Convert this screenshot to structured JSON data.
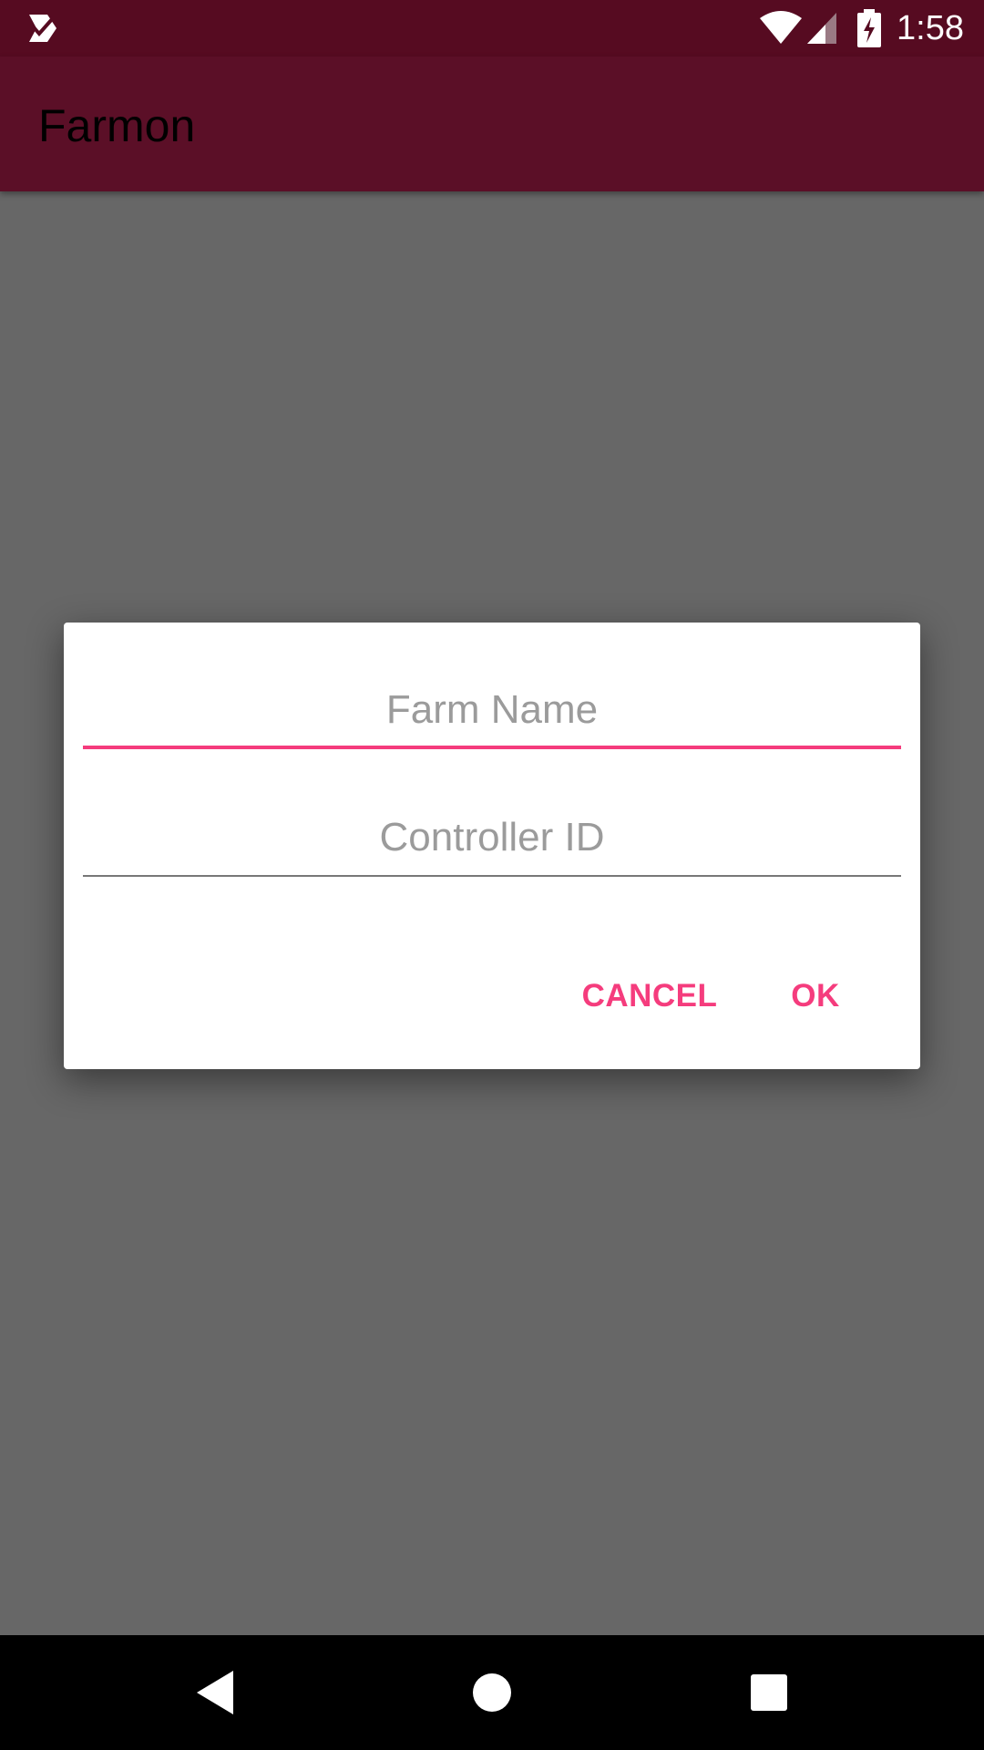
{
  "status_bar": {
    "time": "1:58",
    "icons": [
      "notification-check-icon",
      "wifi-icon",
      "signal-icon",
      "battery-charging-icon"
    ]
  },
  "app_bar": {
    "title": "Farmon"
  },
  "dialog": {
    "farm_name_placeholder": "Farm Name",
    "farm_name_value": "",
    "controller_id_placeholder": "Controller ID",
    "controller_id_value": "",
    "cancel_label": "CANCEL",
    "ok_label": "OK"
  },
  "nav_bar": {
    "icons": [
      "back-icon",
      "home-icon",
      "recents-icon"
    ]
  },
  "colors": {
    "status_bar": "#560b21",
    "app_bar": "#5b0f27",
    "scrim_background": "#676767",
    "accent": "#f53c7d"
  }
}
